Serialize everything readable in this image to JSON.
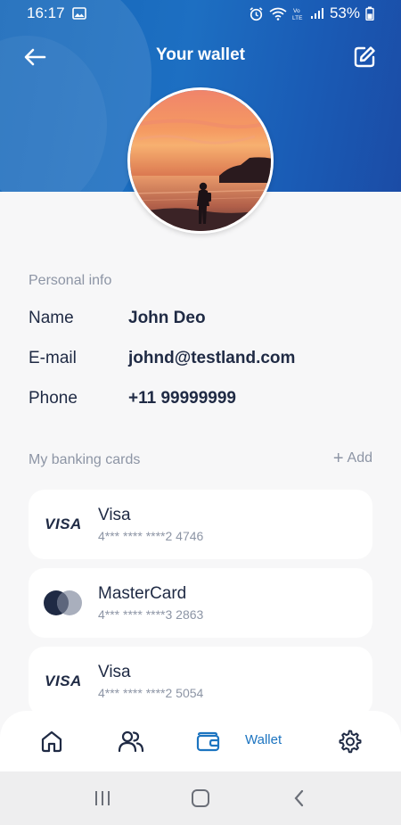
{
  "status_bar": {
    "time": "16:17",
    "battery": "53%"
  },
  "header": {
    "title": "Your wallet"
  },
  "colors": {
    "header_blue": "#1a63b5",
    "accent": "#1c74c0",
    "text_dark": "#1f2a44",
    "text_muted": "#8d95a5"
  },
  "icons": {
    "back": "arrow-left",
    "edit": "pencil-square",
    "home": "home",
    "contacts": "users",
    "wallet": "wallet",
    "settings": "gear"
  },
  "personal_info": {
    "section_label": "Personal info",
    "rows": [
      {
        "key": "Name",
        "value": "John Deo"
      },
      {
        "key": "E-mail",
        "value": "johnd@testland.com"
      },
      {
        "key": "Phone",
        "value": "+11 99999999"
      }
    ]
  },
  "cards_section": {
    "section_label": "My banking cards",
    "add_label": "Add",
    "cards": [
      {
        "brand": "VISA",
        "name": "Visa",
        "number": "4*** **** ****2 4746"
      },
      {
        "brand": "mastercard",
        "name": "MasterCard",
        "number": "4*** **** ****3 2863"
      },
      {
        "brand": "VISA",
        "name": "Visa",
        "number": "4*** **** ****2 5054"
      }
    ]
  },
  "bottom_nav": {
    "active_label": "Wallet"
  }
}
